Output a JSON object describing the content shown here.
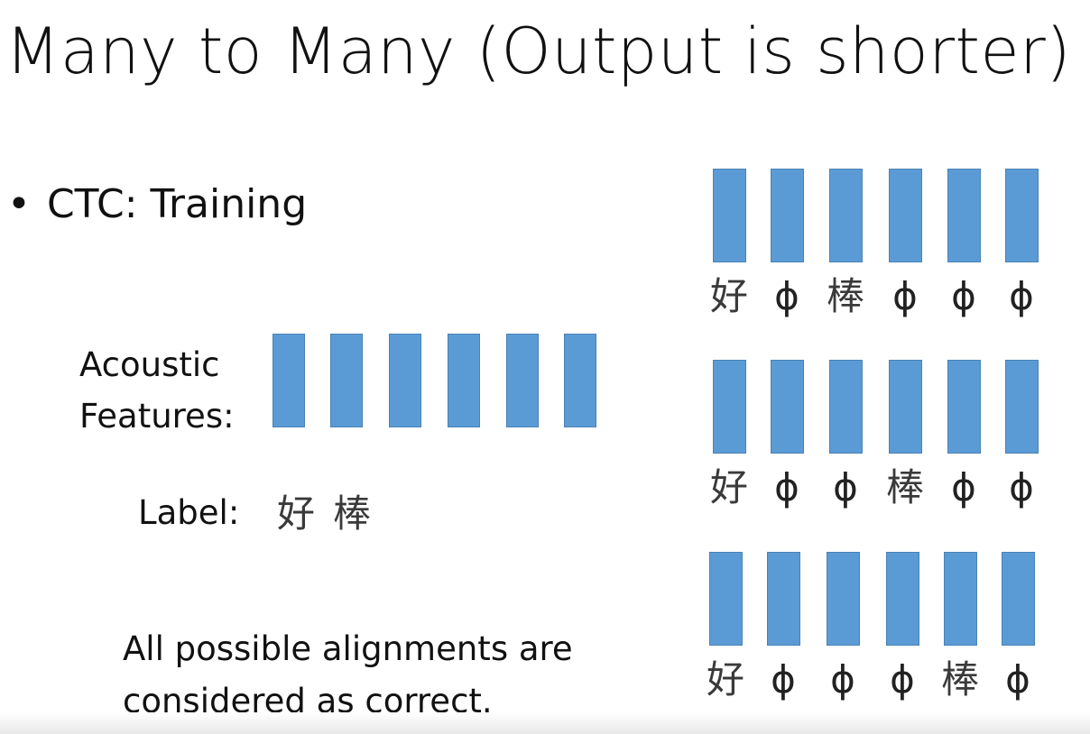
{
  "slide": {
    "title": "Many to Many (Output is shorter)",
    "bullet_symbol": "•",
    "bullet_text": "CTC: Training",
    "acoustic_label_line1": "Acoustic",
    "acoustic_label_line2": "Features:",
    "acoustic_frame_count": 6,
    "label_caption": "Label:",
    "label_tokens": [
      "好",
      "棒"
    ],
    "note_line1": "All possible alignments are",
    "note_line2": "considered as correct.",
    "alignments": [
      [
        "好",
        "ϕ",
        "棒",
        "ϕ",
        "ϕ",
        "ϕ"
      ],
      [
        "好",
        "ϕ",
        "ϕ",
        "棒",
        "ϕ",
        "ϕ"
      ],
      [
        "好",
        "ϕ",
        "ϕ",
        "ϕ",
        "棒",
        "ϕ"
      ]
    ],
    "bar_color": "#5b9bd5"
  }
}
